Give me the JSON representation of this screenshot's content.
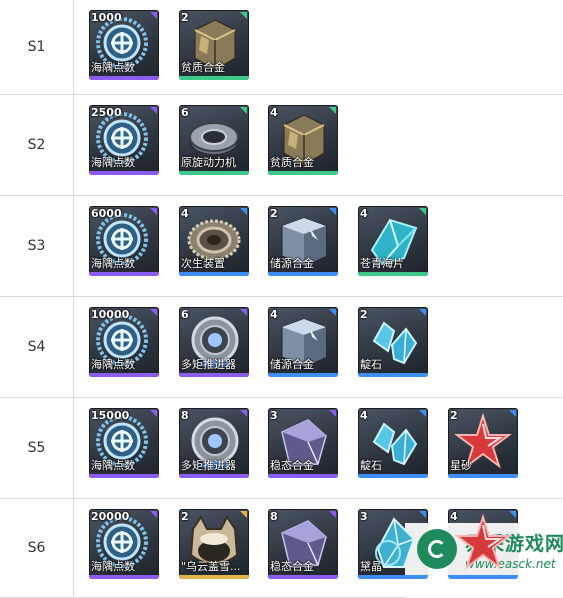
{
  "colors": {
    "purple": "#8a5cf0",
    "blue": "#3f8ef5",
    "green": "#3dc98a"
  },
  "rows": [
    {
      "label": "S1",
      "items": [
        {
          "count": "1000",
          "name": "海隅点数",
          "icon": "haiyu-points-icon",
          "rarity": "purple"
        },
        {
          "count": "2",
          "name": "贫质合金",
          "icon": "poor-alloy-icon",
          "rarity": "green"
        }
      ]
    },
    {
      "label": "S2",
      "items": [
        {
          "count": "2500",
          "name": "海隅点数",
          "icon": "haiyu-points-icon",
          "rarity": "purple"
        },
        {
          "count": "6",
          "name": "原旋动力机",
          "icon": "rotary-engine-icon",
          "rarity": "green"
        },
        {
          "count": "4",
          "name": "贫质合金",
          "icon": "poor-alloy-icon",
          "rarity": "green"
        }
      ]
    },
    {
      "label": "S3",
      "items": [
        {
          "count": "6000",
          "name": "海隅点数",
          "icon": "haiyu-points-icon",
          "rarity": "purple"
        },
        {
          "count": "4",
          "name": "次生装置",
          "icon": "secondary-device-icon",
          "rarity": "blue"
        },
        {
          "count": "2",
          "name": "储源合金",
          "icon": "storage-alloy-icon",
          "rarity": "blue"
        },
        {
          "count": "4",
          "name": "苍青海片",
          "icon": "azure-shard-icon",
          "rarity": "green"
        }
      ]
    },
    {
      "label": "S4",
      "items": [
        {
          "count": "10000",
          "name": "海隅点数",
          "icon": "haiyu-points-icon",
          "rarity": "purple"
        },
        {
          "count": "6",
          "name": "多矩推进器",
          "icon": "thruster-icon",
          "rarity": "purple"
        },
        {
          "count": "4",
          "name": "储源合金",
          "icon": "storage-alloy-icon",
          "rarity": "blue"
        },
        {
          "count": "2",
          "name": "靛石",
          "icon": "indigo-stone-icon",
          "rarity": "blue"
        }
      ]
    },
    {
      "label": "S5",
      "items": [
        {
          "count": "15000",
          "name": "海隅点数",
          "icon": "haiyu-points-icon",
          "rarity": "purple"
        },
        {
          "count": "8",
          "name": "多矩推进器",
          "icon": "thruster-icon",
          "rarity": "purple"
        },
        {
          "count": "3",
          "name": "稳态合金",
          "icon": "stable-alloy-icon",
          "rarity": "purple"
        },
        {
          "count": "4",
          "name": "靛石",
          "icon": "indigo-stone-icon",
          "rarity": "blue"
        },
        {
          "count": "2",
          "name": "星砂",
          "icon": "star-sand-icon",
          "rarity": "blue"
        }
      ]
    },
    {
      "label": "S6",
      "items": [
        {
          "count": "20000",
          "name": "海隅点数",
          "icon": "haiyu-points-icon",
          "rarity": "purple"
        },
        {
          "count": "2",
          "name": "\"乌云盖雪...",
          "icon": "cat-helmet-icon",
          "rarity": "gold"
        },
        {
          "count": "8",
          "name": "稳态合金",
          "icon": "stable-alloy-icon",
          "rarity": "purple"
        },
        {
          "count": "3",
          "name": "黛晶",
          "icon": "dark-crystal-icon",
          "rarity": "blue"
        },
        {
          "count": "4",
          "name": "",
          "icon": "star-sand-icon",
          "rarity": "blue"
        }
      ]
    }
  ],
  "watermark": {
    "title": "易采游戏网",
    "url": "www.easck.net"
  }
}
